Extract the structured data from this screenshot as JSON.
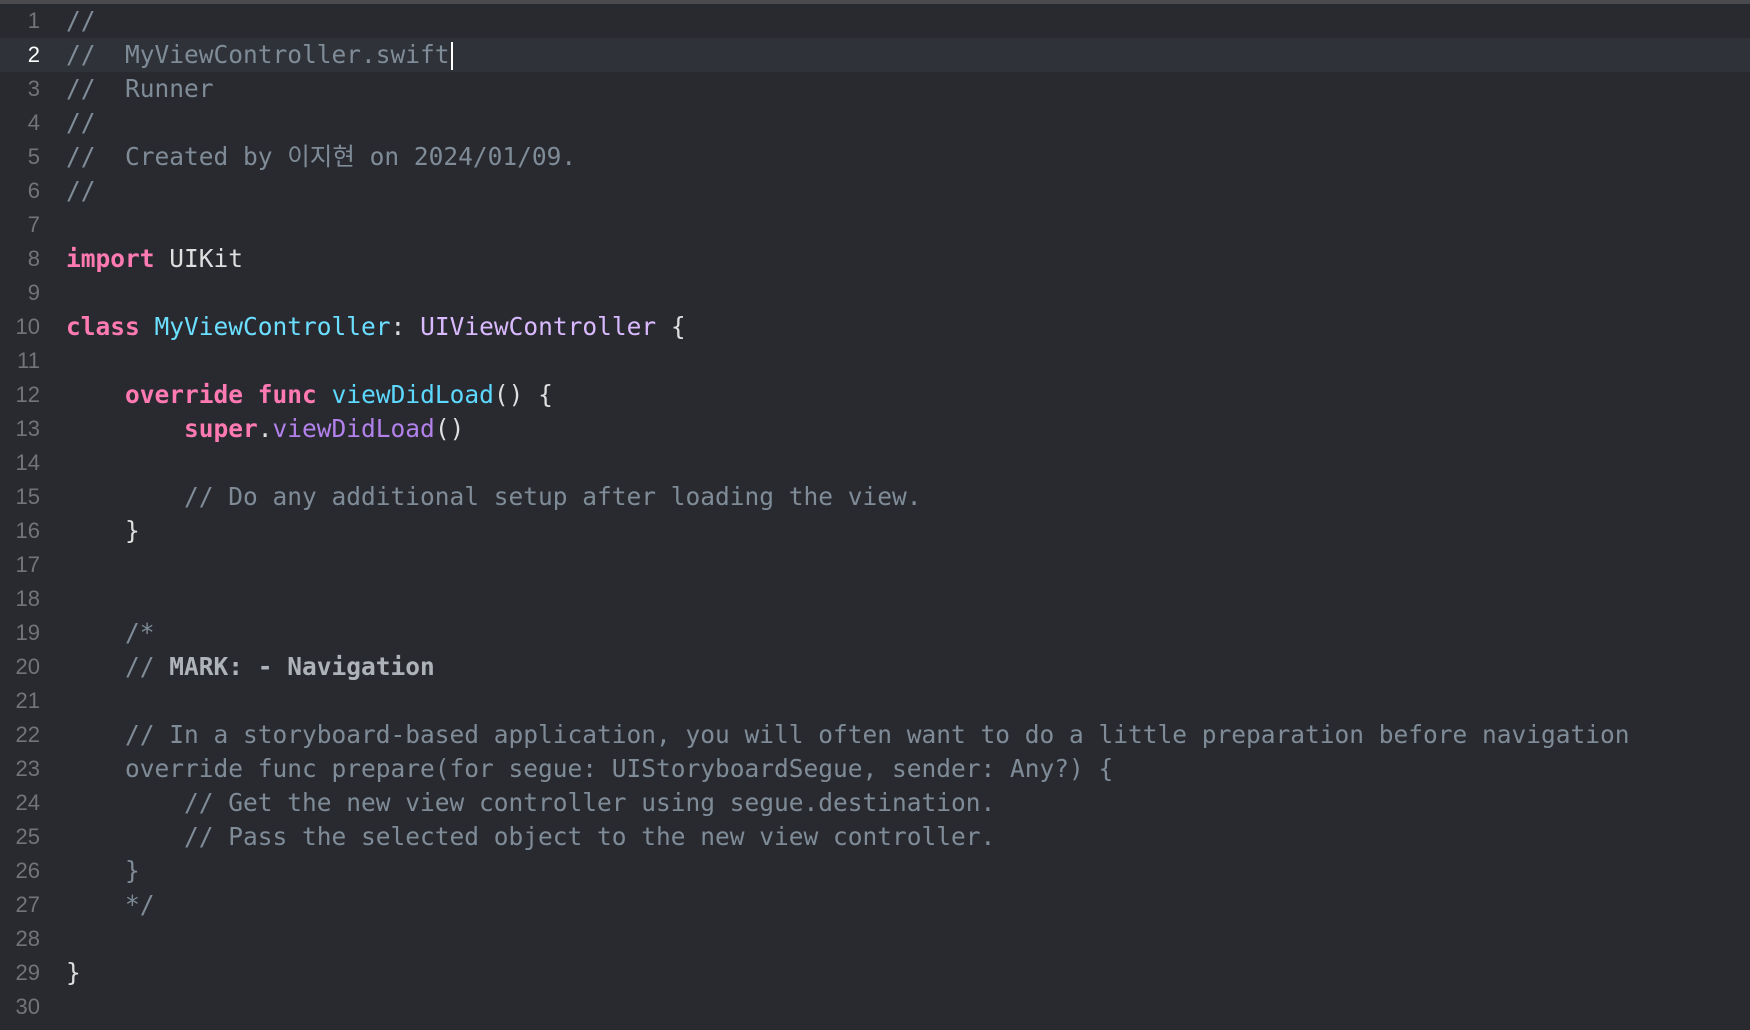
{
  "editor": {
    "language": "swift",
    "current_line": 2,
    "colors": {
      "background": "#292a30",
      "current_line_background": "#2f3239",
      "line_number": "#747478",
      "comment": "#7f8c98",
      "keyword": "#ff7ab2",
      "type_declaration": "#6bdfff",
      "type": "#dabaff",
      "function_declaration": "#5dd8ff",
      "method": "#b281eb",
      "plain": "#dfdfe0"
    },
    "lines": [
      {
        "n": "1",
        "tokens": [
          {
            "t": "comment",
            "v": "//"
          }
        ]
      },
      {
        "n": "2",
        "tokens": [
          {
            "t": "comment",
            "v": "//  MyViewController.swift"
          }
        ]
      },
      {
        "n": "3",
        "tokens": [
          {
            "t": "comment",
            "v": "//  Runner"
          }
        ]
      },
      {
        "n": "4",
        "tokens": [
          {
            "t": "comment",
            "v": "//"
          }
        ]
      },
      {
        "n": "5",
        "tokens": [
          {
            "t": "comment",
            "v": "//  Created by 이지현 on 2024/01/09."
          }
        ]
      },
      {
        "n": "6",
        "tokens": [
          {
            "t": "comment",
            "v": "//"
          }
        ]
      },
      {
        "n": "7",
        "tokens": []
      },
      {
        "n": "8",
        "tokens": [
          {
            "t": "keyword",
            "v": "import"
          },
          {
            "t": "plain",
            "v": " UIKit"
          }
        ]
      },
      {
        "n": "9",
        "tokens": []
      },
      {
        "n": "10",
        "tokens": [
          {
            "t": "keyword",
            "v": "class"
          },
          {
            "t": "plain",
            "v": " "
          },
          {
            "t": "typedecl",
            "v": "MyViewController"
          },
          {
            "t": "plain",
            "v": ": "
          },
          {
            "t": "type",
            "v": "UIViewController"
          },
          {
            "t": "plain",
            "v": " {"
          }
        ]
      },
      {
        "n": "11",
        "tokens": []
      },
      {
        "n": "12",
        "tokens": [
          {
            "t": "plain",
            "v": "    "
          },
          {
            "t": "keyword",
            "v": "override"
          },
          {
            "t": "plain",
            "v": " "
          },
          {
            "t": "keyword",
            "v": "func"
          },
          {
            "t": "plain",
            "v": " "
          },
          {
            "t": "funcdecl",
            "v": "viewDidLoad"
          },
          {
            "t": "plain",
            "v": "() {"
          }
        ]
      },
      {
        "n": "13",
        "tokens": [
          {
            "t": "plain",
            "v": "        "
          },
          {
            "t": "keyword",
            "v": "super"
          },
          {
            "t": "plain",
            "v": "."
          },
          {
            "t": "method",
            "v": "viewDidLoad"
          },
          {
            "t": "plain",
            "v": "()"
          }
        ]
      },
      {
        "n": "14",
        "tokens": []
      },
      {
        "n": "15",
        "tokens": [
          {
            "t": "plain",
            "v": "        "
          },
          {
            "t": "comment",
            "v": "// Do any additional setup after loading the view."
          }
        ]
      },
      {
        "n": "16",
        "tokens": [
          {
            "t": "plain",
            "v": "    }"
          }
        ]
      },
      {
        "n": "17",
        "tokens": []
      },
      {
        "n": "18",
        "tokens": []
      },
      {
        "n": "19",
        "tokens": [
          {
            "t": "plain",
            "v": "    "
          },
          {
            "t": "comment",
            "v": "/*"
          }
        ]
      },
      {
        "n": "20",
        "tokens": [
          {
            "t": "plain",
            "v": "    "
          },
          {
            "t": "comment",
            "v": "// "
          },
          {
            "t": "mark",
            "v": "MARK: - Navigation"
          }
        ]
      },
      {
        "n": "21",
        "tokens": []
      },
      {
        "n": "22",
        "tokens": [
          {
            "t": "plain",
            "v": "    "
          },
          {
            "t": "comment",
            "v": "// In a storyboard-based application, you will often want to do a little preparation before navigation"
          }
        ]
      },
      {
        "n": "23",
        "tokens": [
          {
            "t": "plain",
            "v": "    "
          },
          {
            "t": "comment",
            "v": "override func prepare(for segue: UIStoryboardSegue, sender: Any?) {"
          }
        ]
      },
      {
        "n": "24",
        "tokens": [
          {
            "t": "plain",
            "v": "        "
          },
          {
            "t": "comment",
            "v": "// Get the new view controller using segue.destination."
          }
        ]
      },
      {
        "n": "25",
        "tokens": [
          {
            "t": "plain",
            "v": "        "
          },
          {
            "t": "comment",
            "v": "// Pass the selected object to the new view controller."
          }
        ]
      },
      {
        "n": "26",
        "tokens": [
          {
            "t": "plain",
            "v": "    "
          },
          {
            "t": "comment",
            "v": "}"
          }
        ]
      },
      {
        "n": "27",
        "tokens": [
          {
            "t": "plain",
            "v": "    "
          },
          {
            "t": "comment",
            "v": "*/"
          }
        ]
      },
      {
        "n": "28",
        "tokens": []
      },
      {
        "n": "29",
        "tokens": [
          {
            "t": "plain",
            "v": "}"
          }
        ]
      },
      {
        "n": "30",
        "tokens": []
      }
    ]
  }
}
